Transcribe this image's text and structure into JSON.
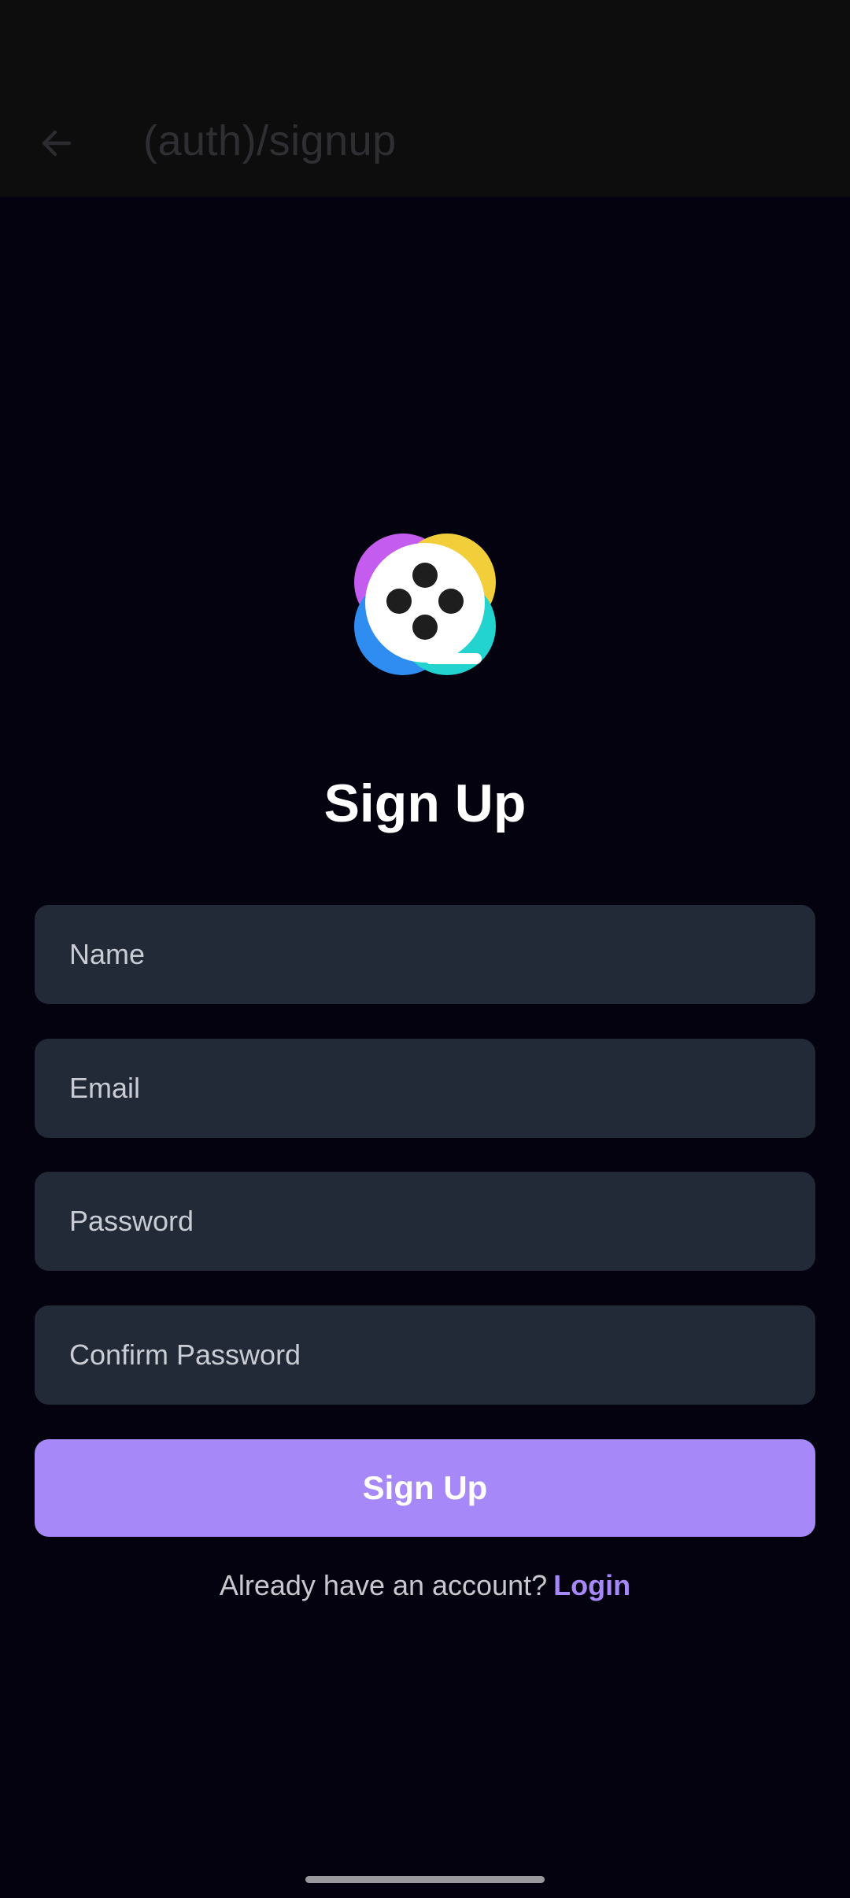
{
  "app_bar": {
    "back_icon": "arrow-left-icon",
    "title": "(auth)/signup"
  },
  "logo": {
    "icon": "film-reel-logo-icon",
    "colors": [
      "#c45cf0",
      "#f2cf3a",
      "#2f8cf0",
      "#22d3cf"
    ]
  },
  "form": {
    "heading": "Sign Up",
    "fields": {
      "name_placeholder": "Name",
      "email_placeholder": "Email",
      "password_placeholder": "Password",
      "confirm_password_placeholder": "Confirm Password"
    },
    "submit_label": "Sign Up"
  },
  "footer": {
    "prompt": "Already have an account?",
    "login_label": "Login"
  },
  "colors": {
    "background": "#04020f",
    "input_background": "#222a38",
    "accent": "#a788f8"
  }
}
